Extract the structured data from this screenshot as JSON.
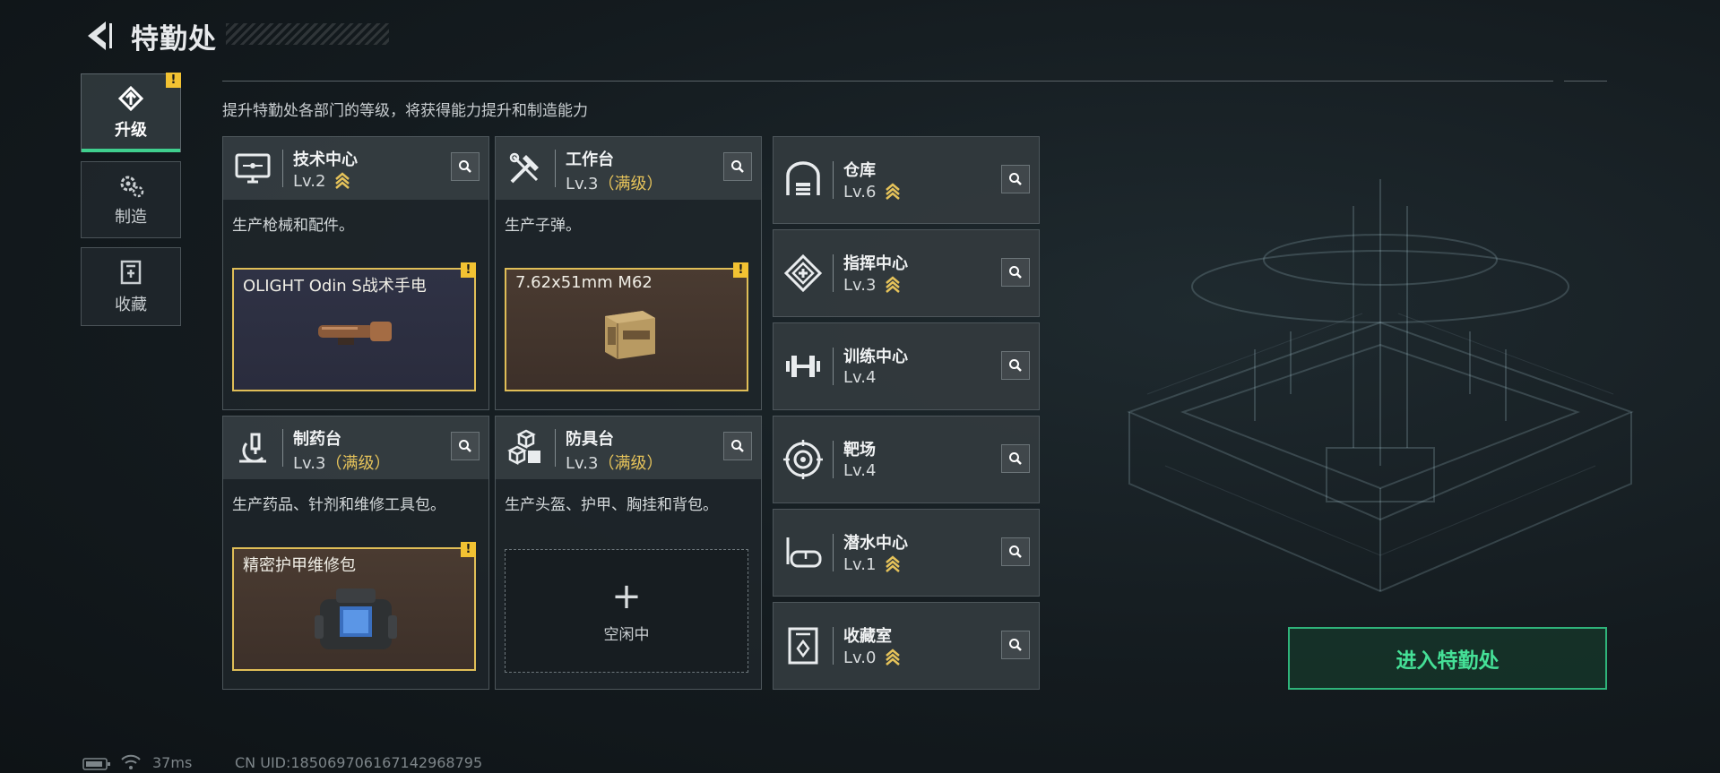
{
  "header": {
    "title": "特勤处"
  },
  "tabs": [
    {
      "label": "升级",
      "icon": "upgrade-icon",
      "active": true,
      "alert": true
    },
    {
      "label": "制造",
      "icon": "gears-icon",
      "active": false,
      "alert": false
    },
    {
      "label": "收藏",
      "icon": "collection-icon",
      "active": false,
      "alert": false
    }
  ],
  "badge_text": "!",
  "subtitle": "提升特勤处各部门的等级，将获得能力提升和制造能力",
  "workshops": [
    {
      "name": "技术中心",
      "level": "Lv.2",
      "maxed": "",
      "desc": "生产枪械和配件。",
      "slot": "OLIGHT Odin S战术手电",
      "icon": "monitor-icon"
    },
    {
      "name": "工作台",
      "level": "Lv.3",
      "maxed": "（满级）",
      "desc": "生产子弹。",
      "slot": "7.62x51mm M62",
      "icon": "tools-icon"
    },
    {
      "name": "制药台",
      "level": "Lv.3",
      "maxed": "（满级）",
      "desc": "生产药品、针剂和维修工具包。",
      "slot": "精密护甲维修包",
      "icon": "microscope-icon"
    },
    {
      "name": "防具台",
      "level": "Lv.3",
      "maxed": "（满级）",
      "desc": "生产头盔、护甲、胸挂和背包。",
      "slot": "",
      "icon": "blocks-icon"
    }
  ],
  "idle": {
    "plus": "+",
    "label": "空闲中"
  },
  "facilities": [
    {
      "name": "仓库",
      "level": "Lv.6",
      "upgradeable": true,
      "icon": "warehouse-icon"
    },
    {
      "name": "指挥中心",
      "level": "Lv.3",
      "upgradeable": true,
      "icon": "command-icon"
    },
    {
      "name": "训练中心",
      "level": "Lv.4",
      "upgradeable": false,
      "icon": "dumbbell-icon"
    },
    {
      "name": "靶场",
      "level": "Lv.4",
      "upgradeable": false,
      "icon": "target-icon"
    },
    {
      "name": "潜水中心",
      "level": "Lv.1",
      "upgradeable": true,
      "icon": "diving-mask-icon"
    },
    {
      "name": "收藏室",
      "level": "Lv.0",
      "upgradeable": true,
      "icon": "collection-room-icon"
    }
  ],
  "enter_button": "进入特勤处",
  "status": {
    "ping": "37ms",
    "uid": "CN UID:18506970616714296879​5"
  },
  "colors": {
    "accent": "#3fcf8e",
    "warning": "#f2c232",
    "gold": "#e6c35a"
  }
}
